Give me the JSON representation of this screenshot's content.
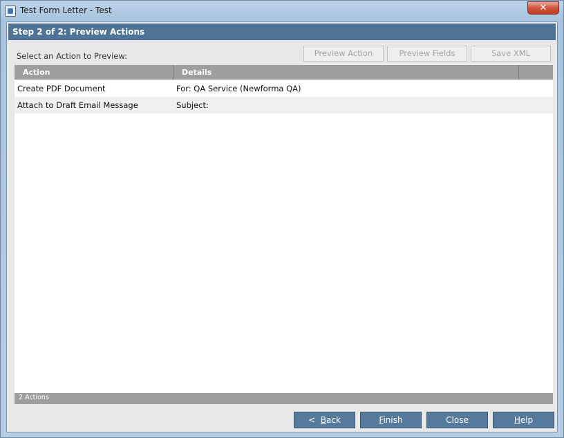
{
  "window": {
    "title": "Test Form Letter - Test",
    "close_glyph": "✕"
  },
  "header": {
    "step_title": "Step 2 of 2:  Preview Actions"
  },
  "toolbar": {
    "select_label": "Select an Action to Preview:",
    "preview_action": "Preview Action",
    "preview_fields": "Preview Fields",
    "save_xml": "Save XML"
  },
  "grid": {
    "columns": [
      "Action",
      "Details"
    ],
    "rows": [
      {
        "action": "Create PDF Document",
        "details": "For: QA Service (Newforma QA)"
      },
      {
        "action": "Attach to Draft Email Message",
        "details": "Subject:"
      }
    ],
    "footer": "2 Actions"
  },
  "buttons": {
    "back_prefix": "<  ",
    "back_mnemonic": "B",
    "back_rest": "ack",
    "finish_mnemonic": "F",
    "finish_rest": "inish",
    "close": "Close",
    "help_mnemonic": "H",
    "help_rest": "elp"
  },
  "icons": {
    "app": "form-letter-icon",
    "close": "close-icon"
  },
  "colors": {
    "header_bg": "#4e7395",
    "grid_header_bg": "#9e9e9e",
    "button_bg": "#557a9c",
    "close_btn": "#c23b24"
  }
}
